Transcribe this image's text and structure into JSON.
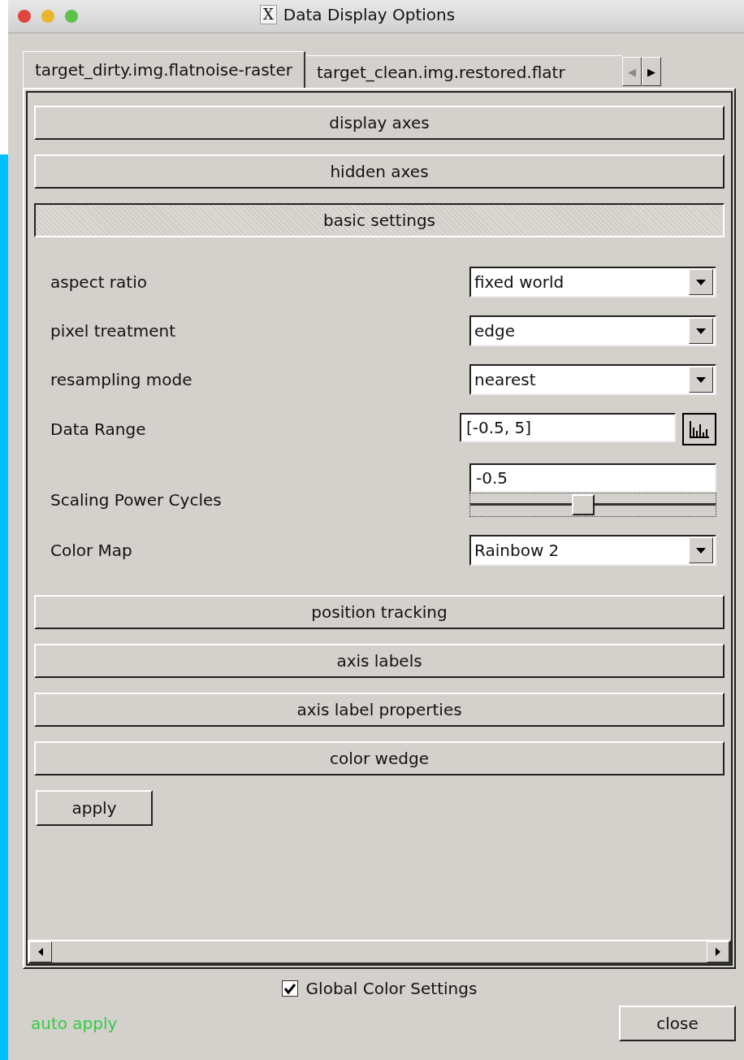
{
  "window": {
    "title": "Data Display Options",
    "icon": "X"
  },
  "tabs": [
    {
      "label": "target_dirty.img.flatnoise-raster",
      "selected": true
    },
    {
      "label": "target_clean.img.restored.flatr",
      "selected": false
    }
  ],
  "tab_scroll": {
    "left": "◀",
    "right": "▶"
  },
  "sections_before": [
    {
      "label": "display axes",
      "expanded": false
    },
    {
      "label": "hidden axes",
      "expanded": false
    },
    {
      "label": "basic settings",
      "expanded": true
    }
  ],
  "settings": [
    {
      "kind": "dropdown",
      "label": "aspect ratio",
      "value": "fixed world"
    },
    {
      "kind": "dropdown",
      "label": "pixel treatment",
      "value": "edge"
    },
    {
      "kind": "dropdown",
      "label": "resampling mode",
      "value": "nearest"
    },
    {
      "kind": "range",
      "label": "Data Range",
      "value": "[-0.5, 5]"
    },
    {
      "kind": "slider",
      "label": "Scaling Power Cycles",
      "value": "-0.5",
      "level": 0.46
    },
    {
      "kind": "dropdown",
      "label": "Color Map",
      "value": "Rainbow 2"
    }
  ],
  "sections_after": [
    {
      "label": "position tracking",
      "expanded": false
    },
    {
      "label": "axis labels",
      "expanded": false
    },
    {
      "label": "axis label properties",
      "expanded": false
    },
    {
      "label": "color wedge",
      "expanded": false
    }
  ],
  "apply_button": "apply",
  "global_color_settings": {
    "label": "Global Color Settings",
    "checked": true
  },
  "auto_apply": "auto apply",
  "close_button": "close"
}
